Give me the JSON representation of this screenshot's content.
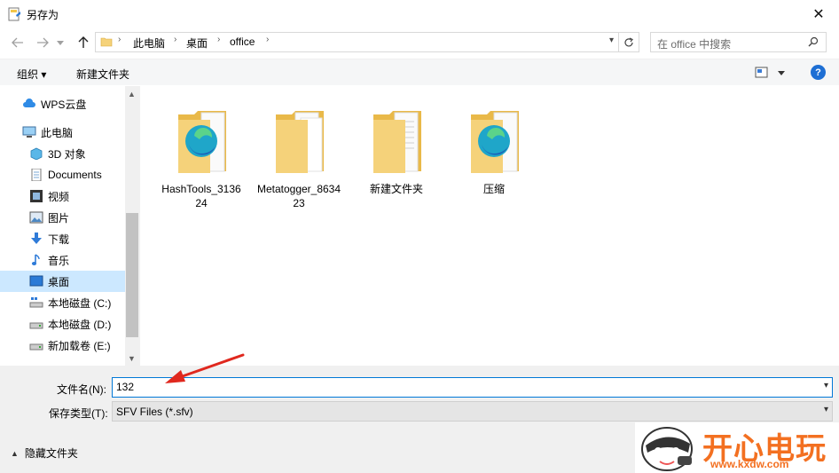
{
  "window": {
    "title": "另存为",
    "close_glyph": "✕"
  },
  "nav": {
    "breadcrumbs": [
      "此电脑",
      "桌面",
      "office"
    ],
    "search_placeholder": "在 office 中搜索"
  },
  "toolbar": {
    "organize_label": "组织 ▾",
    "new_folder_label": "新建文件夹",
    "help_glyph": "?"
  },
  "sidebar": {
    "items": [
      {
        "label": "WPS云盘",
        "icon": "cloud-icon"
      },
      {
        "label": "此电脑",
        "icon": "computer-icon"
      },
      {
        "label": "3D 对象",
        "icon": "cube-icon"
      },
      {
        "label": "Documents",
        "icon": "document-icon"
      },
      {
        "label": "视频",
        "icon": "film-icon"
      },
      {
        "label": "图片",
        "icon": "picture-icon"
      },
      {
        "label": "下载",
        "icon": "download-icon"
      },
      {
        "label": "音乐",
        "icon": "music-icon"
      },
      {
        "label": "桌面",
        "icon": "desktop-icon",
        "selected": true
      },
      {
        "label": "本地磁盘 (C:)",
        "icon": "drive-c-icon"
      },
      {
        "label": "本地磁盘 (D:)",
        "icon": "drive-icon"
      },
      {
        "label": "新加载卷 (E:)",
        "icon": "drive-icon"
      }
    ]
  },
  "files": [
    {
      "name": "HashTools_313624",
      "icon": "edge-folder-icon"
    },
    {
      "name": "Metatogger_863423",
      "icon": "folder-icon"
    },
    {
      "name": "新建文件夹",
      "icon": "folder-icon"
    },
    {
      "name": "压缩",
      "icon": "edge-folder-icon"
    }
  ],
  "form": {
    "filename_label": "文件名(N):",
    "filename_value": "132",
    "filetype_label": "保存类型(T):",
    "filetype_value": "SFV Files (*.sfv)"
  },
  "footer": {
    "hide_folders_label": "隐藏文件夹"
  },
  "watermark": {
    "brand": "开心电玩",
    "url": "www.kxdw.com"
  },
  "colors": {
    "accent": "#0078d7",
    "selected_bg": "#cce8ff",
    "folder": "#f5d27a",
    "arrow": "#e0281e",
    "watermark": "#f37021"
  }
}
